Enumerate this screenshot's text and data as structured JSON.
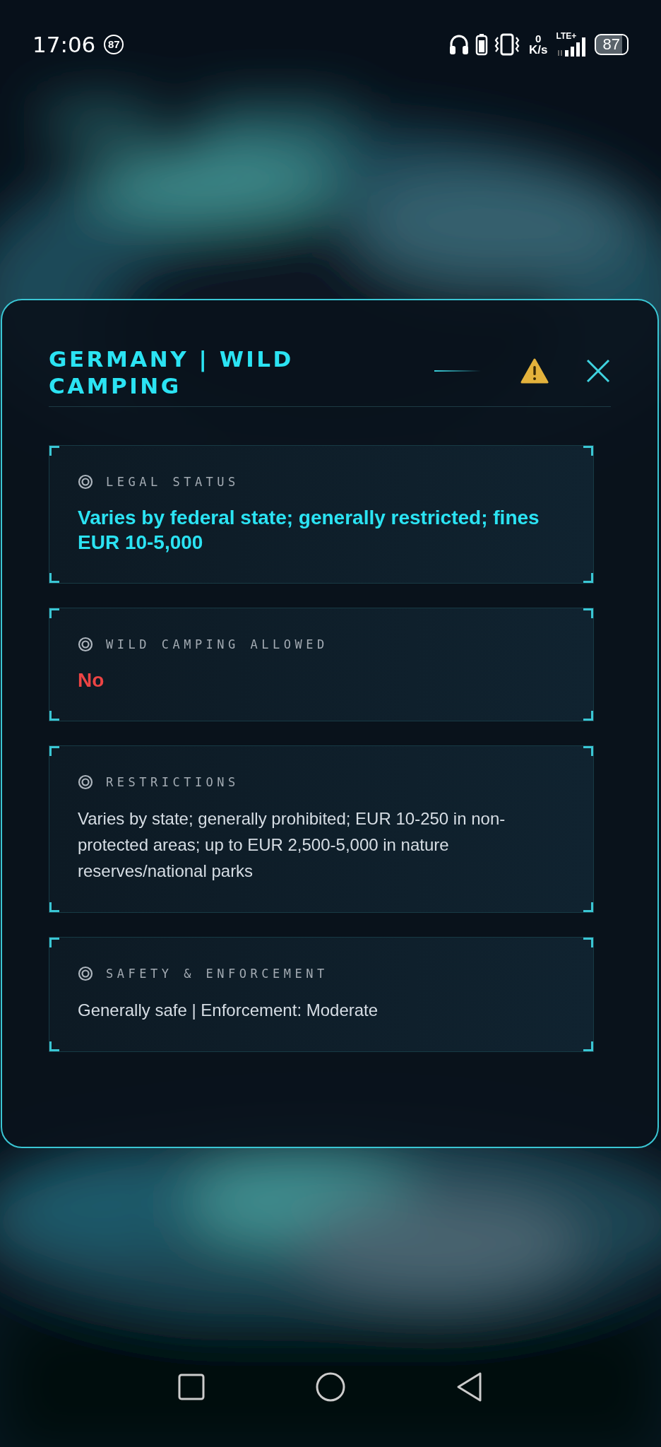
{
  "status_bar": {
    "time": "17:06",
    "notification_count": "87",
    "net_speed_value": "0",
    "net_speed_unit": "K/s",
    "network_type": "LTE+",
    "battery": "87"
  },
  "dialog": {
    "title": "GERMANY | WILD CAMPING",
    "sections": [
      {
        "label": "LEGAL STATUS",
        "value": "Varies by federal state; generally restricted; fines EUR 10-5,000",
        "kind": "emphasis"
      },
      {
        "label": "WILD CAMPING ALLOWED",
        "value": "No",
        "kind": "alert"
      },
      {
        "label": "RESTRICTIONS",
        "value": "Varies by state; generally prohibited; EUR 10-250 in non-protected areas; up to EUR 2,500-5,000 in nature reserves/national parks",
        "kind": "plain"
      },
      {
        "label": "SAFETY & ENFORCEMENT",
        "value": "Generally safe | Enforcement: Moderate",
        "kind": "plain"
      }
    ]
  }
}
